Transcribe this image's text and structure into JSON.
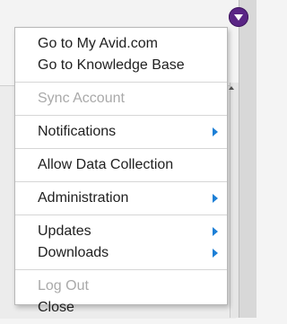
{
  "menu": {
    "groups": [
      {
        "items": [
          {
            "label": "Go to My Avid.com",
            "enabled": true,
            "submenu": false
          },
          {
            "label": "Go to Knowledge Base",
            "enabled": true,
            "submenu": false
          }
        ]
      },
      {
        "items": [
          {
            "label": "Sync Account",
            "enabled": false,
            "submenu": false
          }
        ]
      },
      {
        "items": [
          {
            "label": "Notifications",
            "enabled": true,
            "submenu": true
          }
        ]
      },
      {
        "items": [
          {
            "label": "Allow Data Collection",
            "enabled": true,
            "submenu": false
          }
        ]
      },
      {
        "items": [
          {
            "label": "Administration",
            "enabled": true,
            "submenu": true
          }
        ]
      },
      {
        "items": [
          {
            "label": "Updates",
            "enabled": true,
            "submenu": true
          },
          {
            "label": "Downloads",
            "enabled": true,
            "submenu": true
          }
        ]
      },
      {
        "items": [
          {
            "label": "Log Out",
            "enabled": false,
            "submenu": false
          },
          {
            "label": "Close",
            "enabled": true,
            "submenu": false
          }
        ]
      }
    ]
  },
  "trigger": {
    "icon": "chevron-down-icon",
    "color": "#5a2585"
  },
  "colors": {
    "submenu_arrow": "#1d7fd6",
    "disabled_text": "#a9a9a9"
  }
}
